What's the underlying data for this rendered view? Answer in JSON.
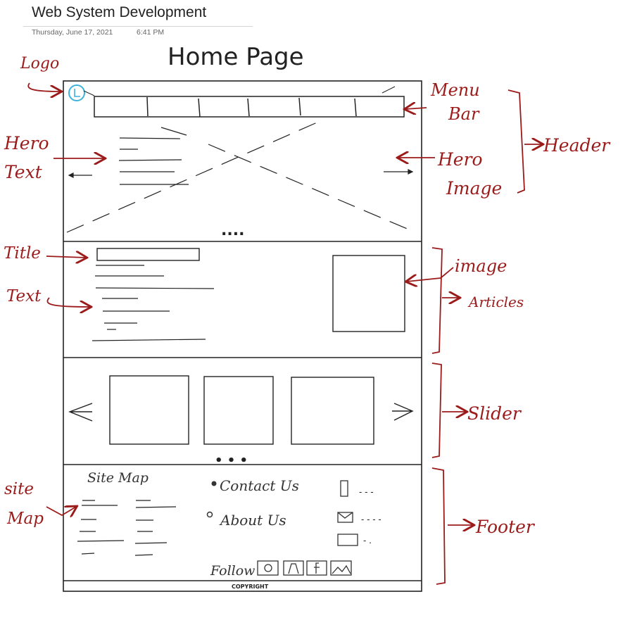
{
  "page": {
    "title": "Web System Development",
    "date": "Thursday, June 17, 2021",
    "time": "6:41 PM"
  },
  "sketch": {
    "heading": "Home Page",
    "header_dots": "....",
    "slider_dots": "• • •",
    "footer": {
      "site_map": "Site Map",
      "contact": "Contact Us",
      "about": "About Us",
      "follow": "Follow",
      "copyright": "COPYRIGHT",
      "contact_dashes": [
        "- - -",
        "- - - -",
        "- ."
      ]
    }
  },
  "annotations": {
    "logo": "Logo",
    "hero_text_1": "Hero",
    "hero_text_2": "Text",
    "menu_1": "Menu",
    "menu_2": "Bar",
    "header": "Header",
    "hero_image_1": "Hero",
    "hero_image_2": "Image",
    "title": "Title",
    "text": "Text",
    "image": "image",
    "articles": "Articles",
    "slider": "Slider",
    "site_map_1": "site",
    "site_map_2": "Map",
    "footer": "Footer"
  },
  "colors": {
    "ink": "#9b1b1b",
    "pencil": "#222222",
    "logo": "#3bb3d9"
  }
}
